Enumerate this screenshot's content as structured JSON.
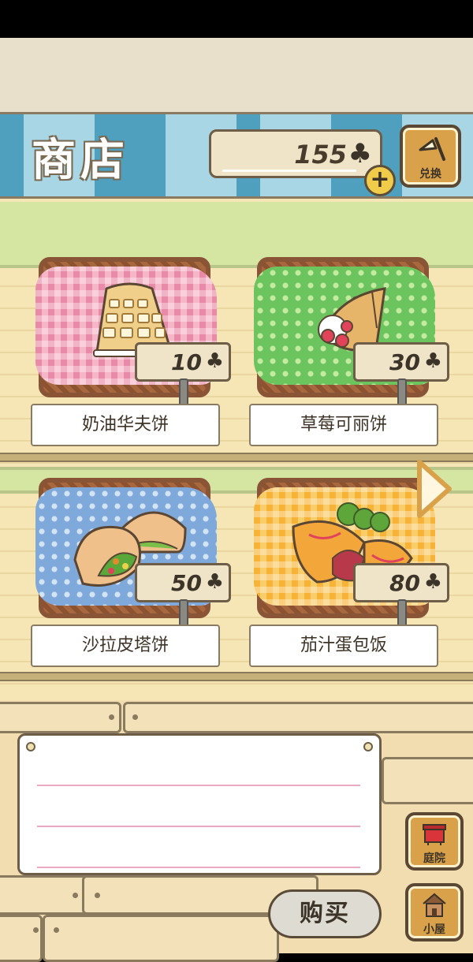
{
  "header": {
    "title": "商店",
    "clover_count": "155",
    "clover_icon": "♣",
    "plus_label": "+",
    "exchange_label": "兑换"
  },
  "items": [
    {
      "name": "奶油华夫饼",
      "price": "10",
      "cloth": "pink"
    },
    {
      "name": "草莓可丽饼",
      "price": "30",
      "cloth": "green"
    },
    {
      "name": "沙拉皮塔饼",
      "price": "50",
      "cloth": "blue"
    },
    {
      "name": "茄汁蛋包饭",
      "price": "80",
      "cloth": "yellow"
    }
  ],
  "actions": {
    "buy_label": "购买",
    "yard_label": "庭院",
    "house_label": "小屋"
  },
  "colors": {
    "awning_dark": "#4f9fbf",
    "awning_light": "#a8d6e4",
    "wood": "#d9a24a",
    "accent_pink_line": "#e9a9c4"
  }
}
